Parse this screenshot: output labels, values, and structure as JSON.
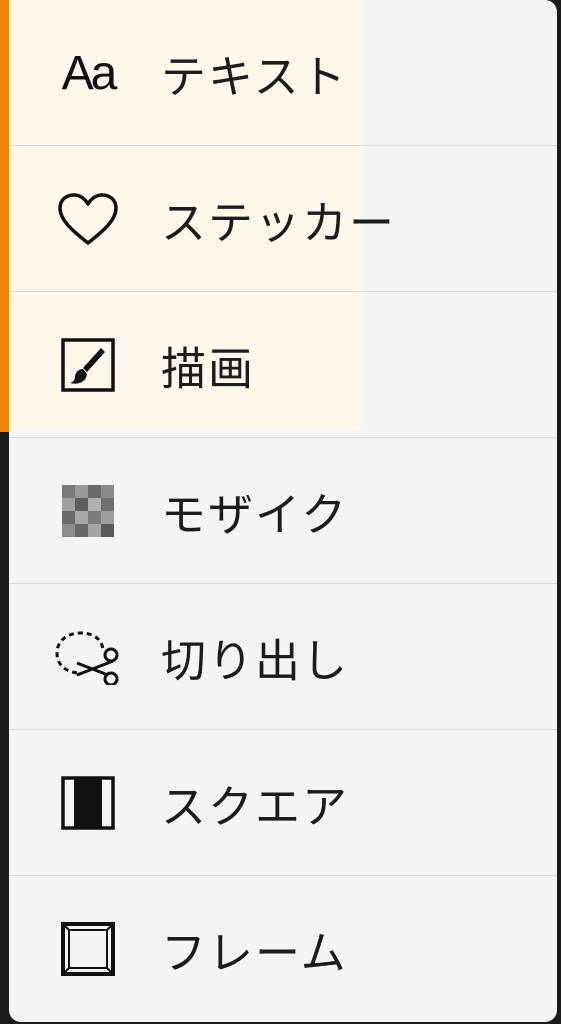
{
  "menu": {
    "accent_color": "#f2840c",
    "items": [
      {
        "label": "テキスト",
        "icon": "text-aa-icon",
        "icon_text": "Aa",
        "selected": true
      },
      {
        "label": "ステッカー",
        "icon": "heart-icon",
        "selected": true
      },
      {
        "label": "描画",
        "icon": "paintbrush-icon",
        "selected": true
      },
      {
        "label": "モザイク",
        "icon": "mosaic-icon",
        "selected": false
      },
      {
        "label": "切り出し",
        "icon": "scissors-icon",
        "selected": false
      },
      {
        "label": "スクエア",
        "icon": "square-crop-icon",
        "selected": false
      },
      {
        "label": "フレーム",
        "icon": "frame-icon",
        "selected": false
      }
    ]
  }
}
